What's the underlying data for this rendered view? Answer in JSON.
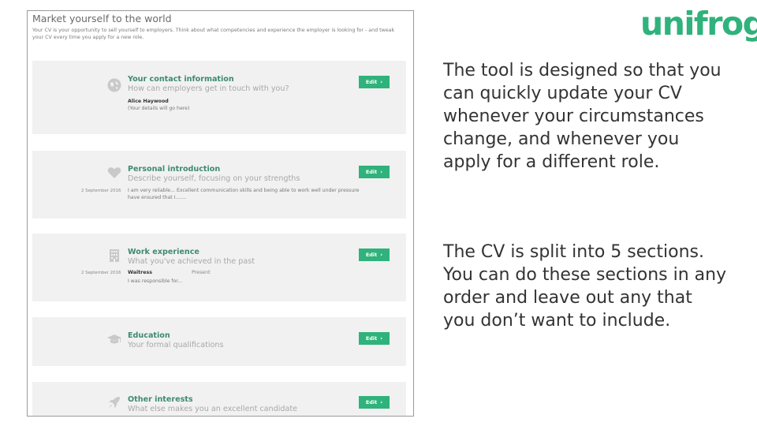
{
  "logo": {
    "text": "unifrog",
    "color": "#2fb27b"
  },
  "panel": {
    "title": "Market yourself to the world",
    "intro": "Your CV is your opportunity to sell yourself to employers. Think about what competencies and experience the employer is looking for - and tweak your CV every time you apply for a new role."
  },
  "sections": [
    {
      "icon": "globe-icon",
      "title": "Your contact information",
      "subtitle": "How can employers get in touch with you?",
      "name": "Alice Haywood",
      "note": "(Your details will go here)",
      "edit_label": "Edit"
    },
    {
      "icon": "heart-icon",
      "title": "Personal introduction",
      "subtitle": "Describe yourself, focusing on your strengths",
      "date": "2 September 2016",
      "note": "I am very reliable... Excellent communication skills and being able to work well under pressure have ensured that I.......",
      "edit_label": "Edit"
    },
    {
      "icon": "building-icon",
      "title": "Work experience",
      "subtitle": "What you've achieved in the past",
      "date": "2 September 2016",
      "name": "Waitress",
      "extra": "Present",
      "note": "I was responsible for...",
      "edit_label": "Edit"
    },
    {
      "icon": "graduation-cap-icon",
      "title": "Education",
      "subtitle": "Your formal qualifications",
      "edit_label": "Edit"
    },
    {
      "icon": "rocket-icon",
      "title": "Other interests",
      "subtitle": "What else makes you an excellent candidate",
      "edit_label": "Edit"
    }
  ],
  "description": {
    "paragraph1": "The tool is designed so that you can quickly update your CV whenever your circumstances change, and whenever you apply for a different role.",
    "paragraph2": "The CV is split into 5 sections. You can do these sections in any order and leave out any that you don’t want to include."
  },
  "colors": {
    "accent": "#2fb27b",
    "section_title": "#3d8a6e",
    "card_bg": "#f1f1f1"
  }
}
